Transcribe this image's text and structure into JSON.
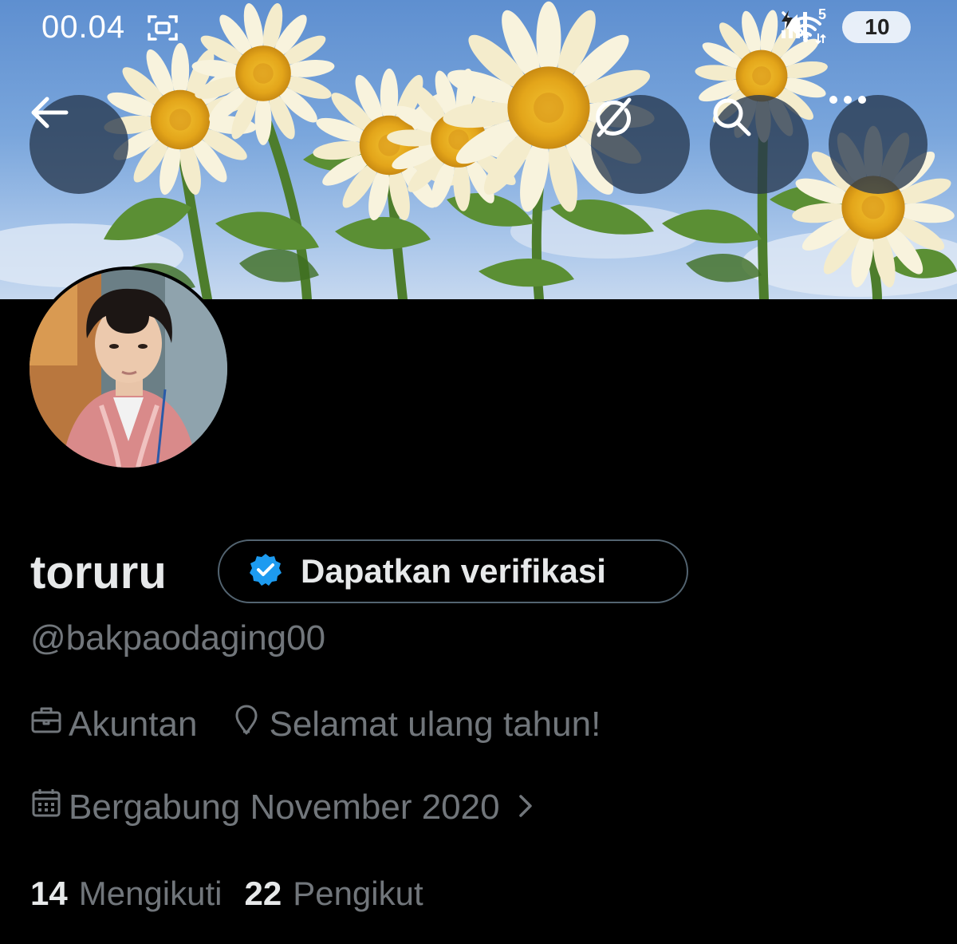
{
  "status_bar": {
    "time": "00.04",
    "battery_level": "10",
    "wifi_label": "5",
    "icons": [
      "screenshot-icon",
      "mute-icon",
      "wifi-icon",
      "signal-icon",
      "battery-charging-icon"
    ]
  },
  "header": {
    "buttons": [
      "back-arrow-icon",
      "grok-icon",
      "search-icon",
      "more-icon"
    ]
  },
  "profile": {
    "display_name": "toruru",
    "verify_label": "Dapatkan verifikasi",
    "handle": "@bakpaodaging00",
    "profession": "Akuntan",
    "location": "Selamat ulang tahun!",
    "joined": "Bergabung November 2020",
    "following_count": "14",
    "following_label": "Mengikuti",
    "followers_count": "22",
    "followers_label": "Pengikut"
  },
  "colors": {
    "background": "#000000",
    "primary_text": "#e7e9ea",
    "secondary_text": "#71767b",
    "verified_blue": "#1d9bf0",
    "pill_border": "#536471"
  }
}
